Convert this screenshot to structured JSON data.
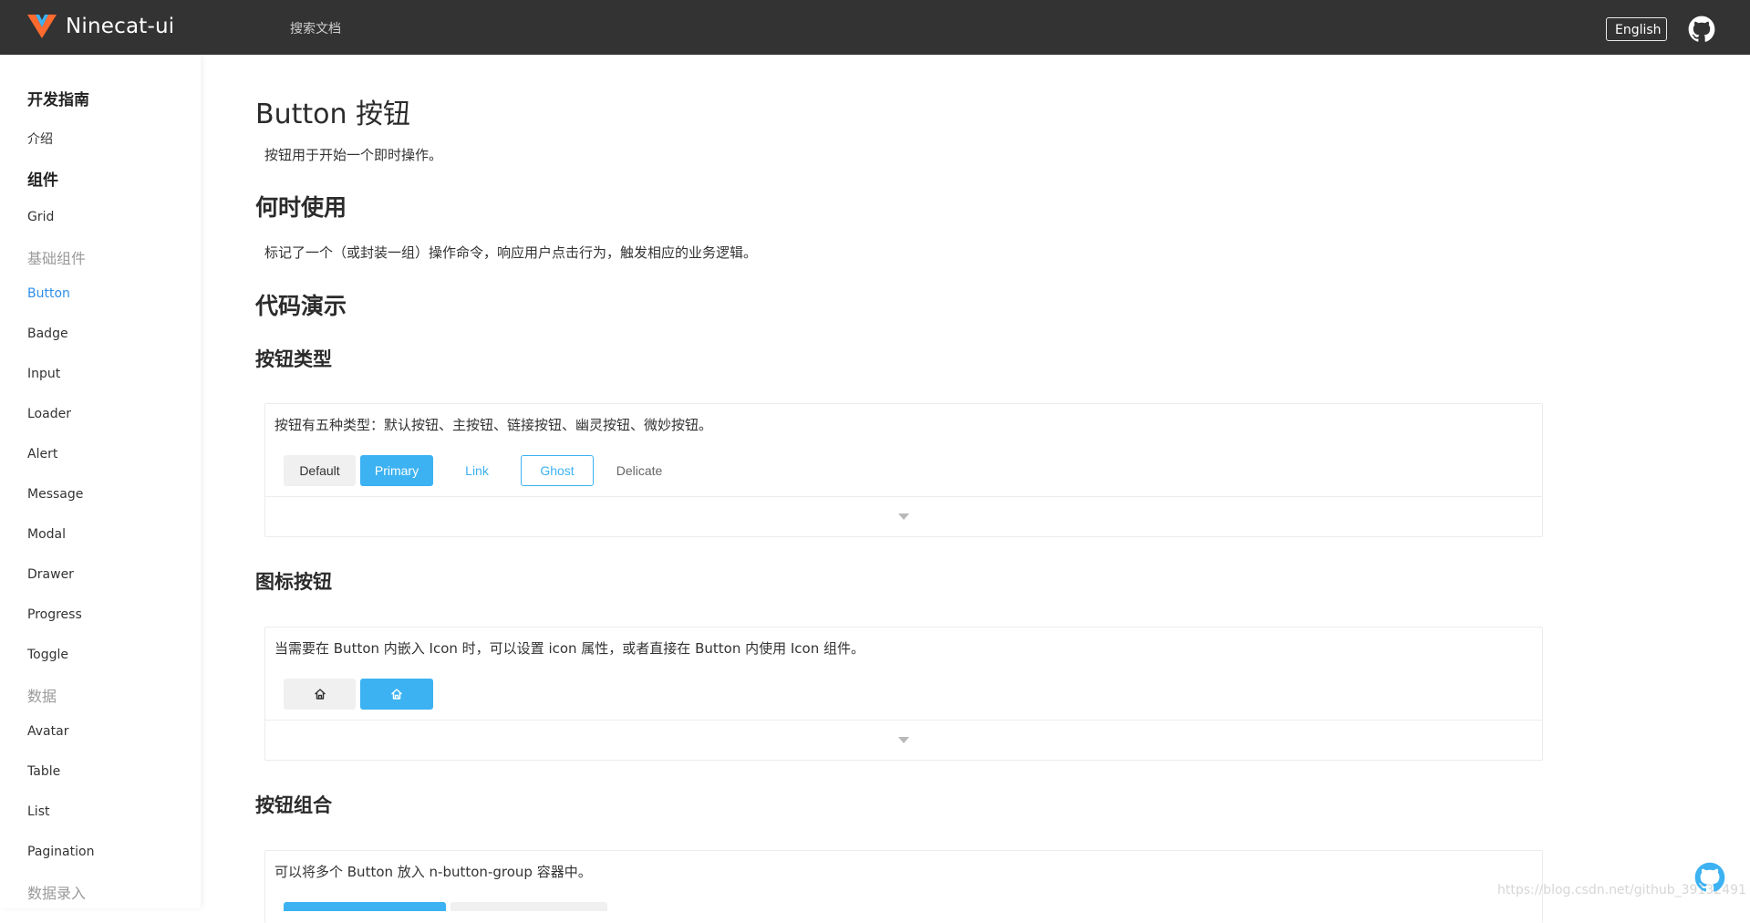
{
  "header": {
    "app_name": "Ninecat-ui",
    "search_placeholder": "搜索文档",
    "lang_button": "English",
    "github_icon": "github-icon",
    "colors": {
      "bg": "#333333",
      "text": "#ffffff"
    }
  },
  "sidebar": {
    "sections": [
      {
        "label": "开发指南"
      },
      {
        "label": "组件"
      }
    ],
    "items": {
      "intro": "介绍",
      "grid": "Grid",
      "basic": "基础组件",
      "button": "Button",
      "badge": "Badge",
      "input": "Input",
      "loader": "Loader",
      "alert": "Alert",
      "message": "Message",
      "modal": "Modal",
      "drawer": "Drawer",
      "progress": "Progress",
      "toggle": "Toggle",
      "data": "数据",
      "avatar": "Avatar",
      "table": "Table",
      "list": "List",
      "pagination": "Pagination",
      "data_entry": "数据录入"
    },
    "active_color": "#2e8fe8"
  },
  "main": {
    "title": "Button 按钮",
    "intro": "按钮用于开始一个即时操作。",
    "when_title": "何时使用",
    "when_text": "标记了一个（或封装一组）操作命令，响应用户点击行为，触发相应的业务逻辑。",
    "demo_title": "代码演示",
    "sections": [
      {
        "title": "按钮类型",
        "desc": "按钮有五种类型：默认按钮、主按钮、链接按钮、幽灵按钮、微妙按钮。",
        "buttons": [
          "Default",
          "Primary",
          "Link",
          "Ghost",
          "Delicate"
        ]
      },
      {
        "title": "图标按钮",
        "desc": "当需要在 Button 内嵌入 Icon 时，可以设置 icon 属性，或者直接在 Button 内使用 Icon 组件。",
        "icons": [
          "home-icon",
          "home-icon"
        ]
      },
      {
        "title": "按钮组合",
        "desc": "可以将多个 Button 放入 n-button-group 容器中。"
      }
    ],
    "primary_color": "#3cb2f2"
  },
  "watermark": "https://blog.csdn.net/github_39132491"
}
